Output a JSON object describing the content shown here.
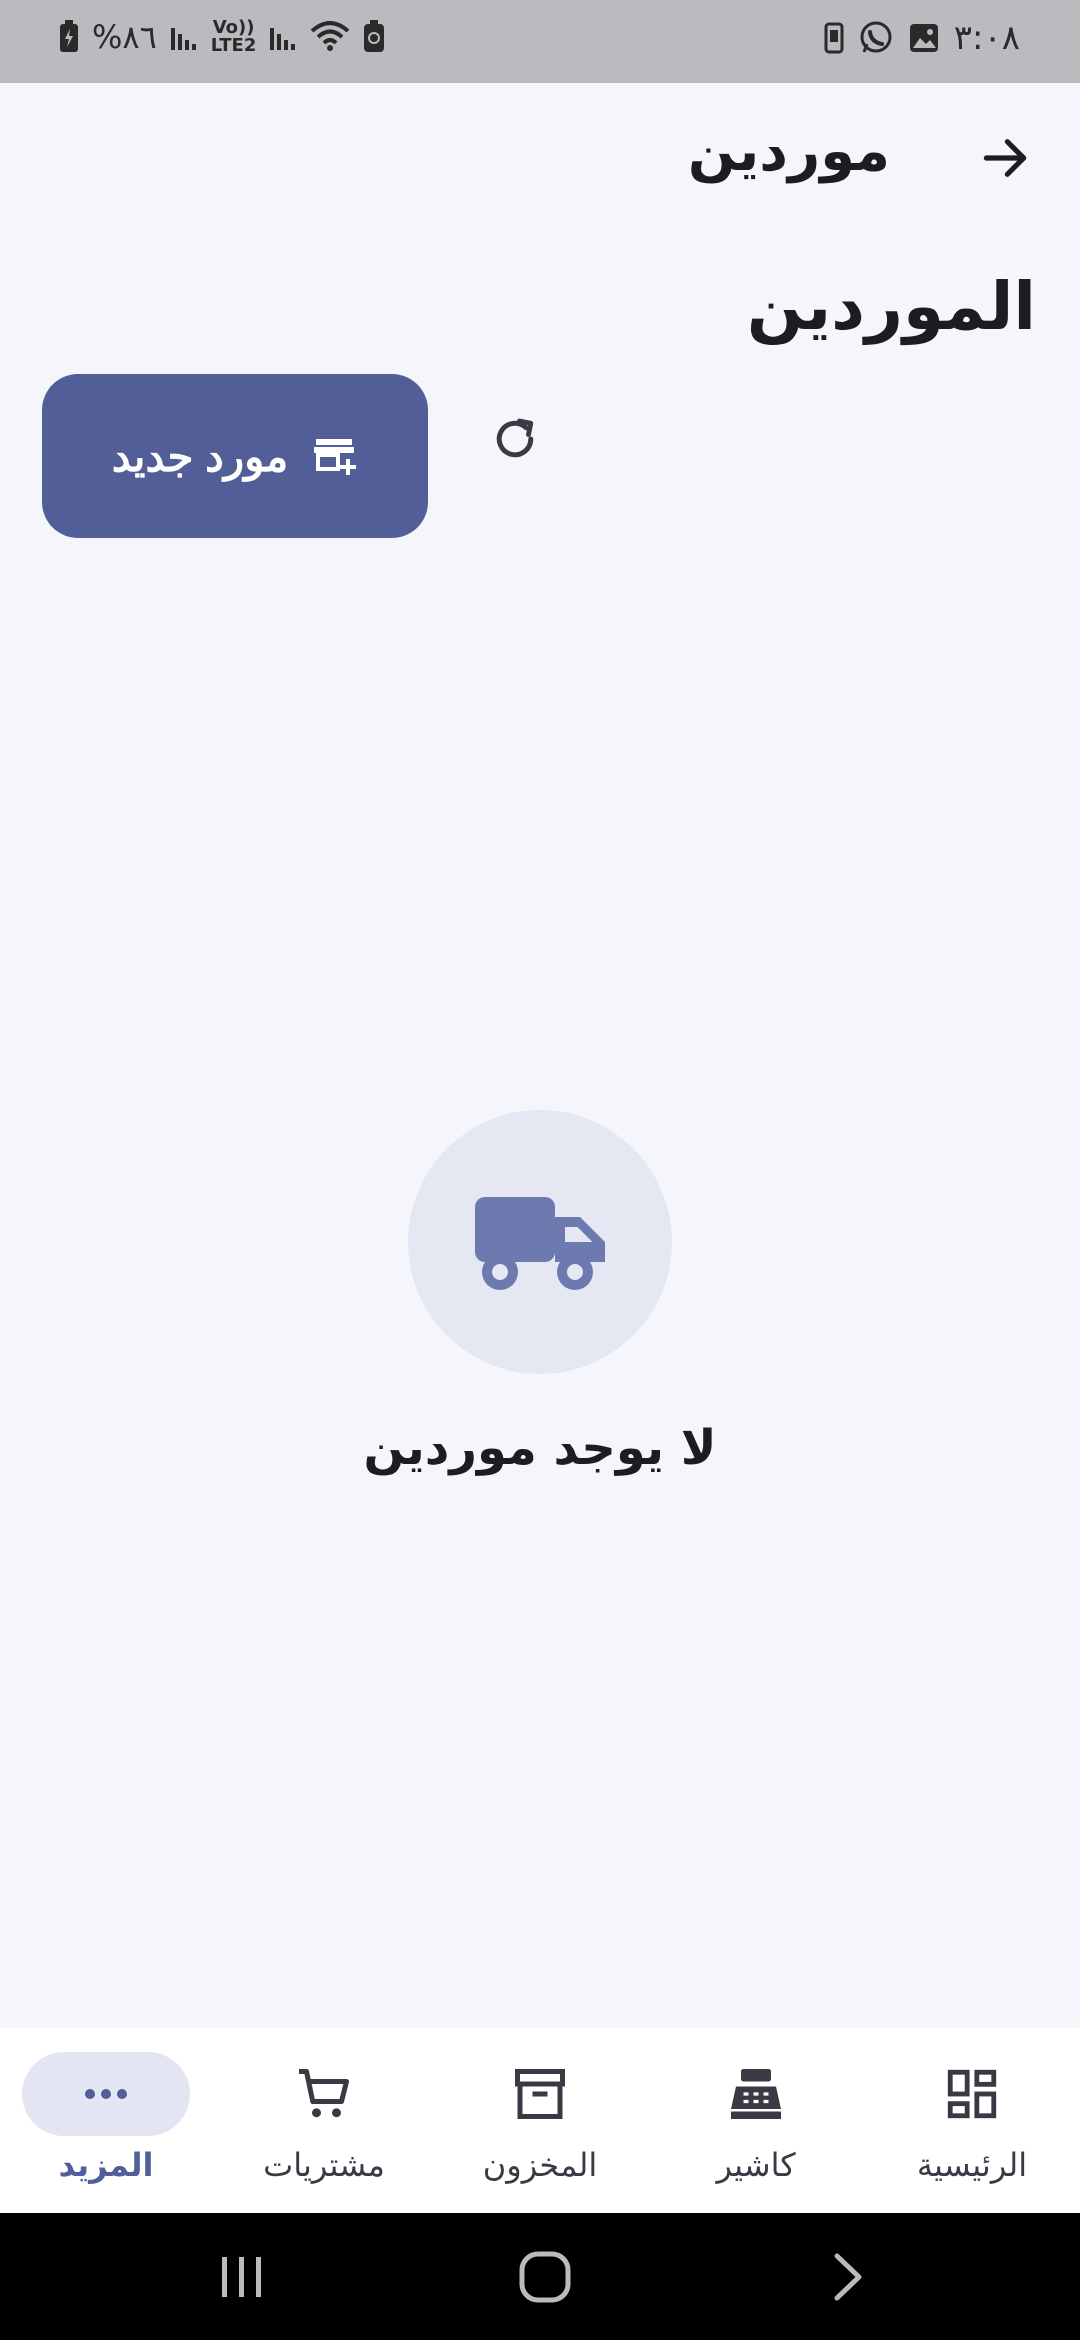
{
  "status_bar": {
    "time": "٣:٠٨",
    "battery": "%٨٦",
    "network_top": "Vo))",
    "network_bottom": "LTE2"
  },
  "app_bar": {
    "title": "موردين",
    "back_icon": "arrow-forward-icon"
  },
  "page": {
    "section_title": "الموردين",
    "new_supplier_label": "مورد جديد",
    "new_supplier_icon": "store-add-icon",
    "refresh_icon": "refresh-icon",
    "empty_icon": "truck-icon",
    "empty_text": "لا يوجد موردين"
  },
  "bottom_nav": {
    "items": [
      {
        "label": "الرئيسية",
        "icon": "dashboard-icon",
        "active": false
      },
      {
        "label": "كاشير",
        "icon": "cash-register-icon",
        "active": false
      },
      {
        "label": "المخزون",
        "icon": "archive-icon",
        "active": false
      },
      {
        "label": "مشتريات",
        "icon": "cart-icon",
        "active": false
      },
      {
        "label": "المزيد",
        "icon": "more-icon",
        "active": true
      }
    ]
  },
  "colors": {
    "primary": "#515e98",
    "background": "#f4f6fb",
    "active_pill": "#e3e6f2",
    "empty_icon": "#6d7ab0"
  }
}
